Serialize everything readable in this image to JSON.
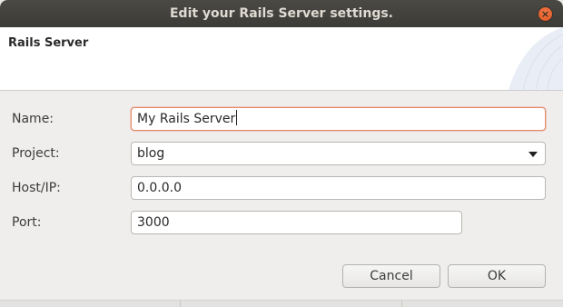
{
  "window": {
    "title": "Edit your Rails Server settings.",
    "close_glyph": "×"
  },
  "header": {
    "title": "Rails Server"
  },
  "form": {
    "name_label": "Name:",
    "name_value": "My Rails Server",
    "project_label": "Project:",
    "project_value": "blog",
    "host_label": "Host/IP:",
    "host_value": "0.0.0.0",
    "port_label": "Port:",
    "port_value": "3000"
  },
  "buttons": {
    "cancel_label": "Cancel",
    "ok_label": "OK"
  },
  "colors": {
    "titlebar": "#3c3b37",
    "close_button": "#e0541d",
    "focus_border": "#e58a6a",
    "dialog_bg": "#efeeed"
  },
  "icons": {
    "close": "close-icon",
    "dropdown": "dropdown-arrow-icon"
  }
}
